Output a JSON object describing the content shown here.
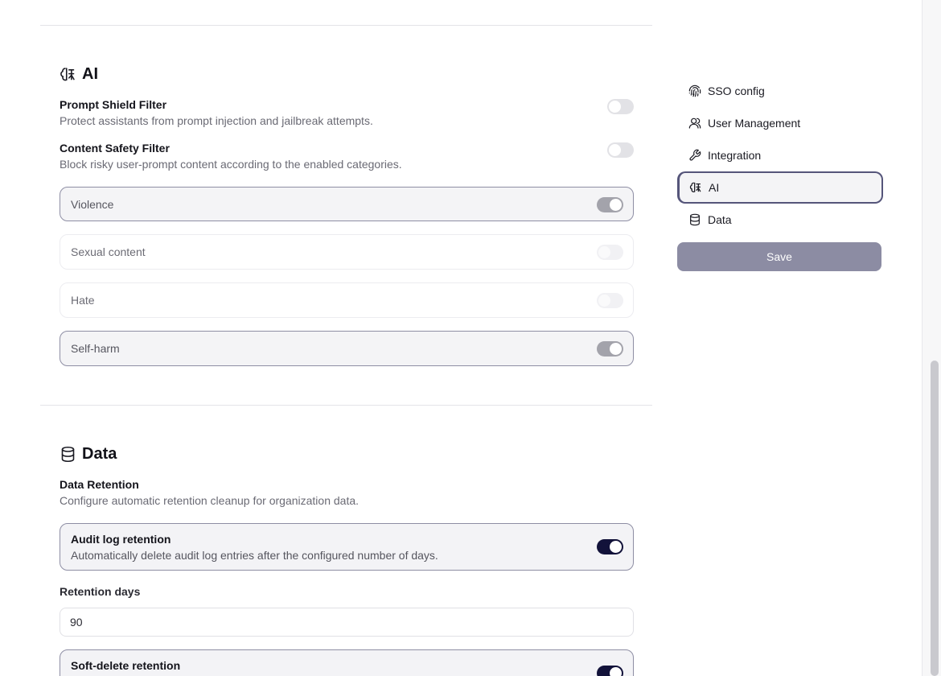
{
  "ai_section": {
    "title": "AI",
    "icon": "ai-brain-icon",
    "prompt_shield": {
      "title": "Prompt Shield Filter",
      "description": "Protect assistants from prompt injection and jailbreak attempts.",
      "enabled": false
    },
    "content_safety": {
      "title": "Content Safety Filter",
      "description": "Block risky user-prompt content according to the enabled categories.",
      "enabled": false
    },
    "categories": [
      {
        "label": "Violence",
        "enabled": true
      },
      {
        "label": "Sexual content",
        "enabled": false
      },
      {
        "label": "Hate",
        "enabled": false
      },
      {
        "label": "Self-harm",
        "enabled": true
      }
    ]
  },
  "data_section": {
    "title": "Data",
    "icon": "database-icon",
    "retention": {
      "title": "Data Retention",
      "description": "Configure automatic retention cleanup for organization data."
    },
    "audit_log": {
      "title": "Audit log retention",
      "description": "Automatically delete audit log entries after the configured number of days.",
      "enabled": true
    },
    "retention_days": {
      "label": "Retention days",
      "value": "90"
    },
    "soft_delete": {
      "title": "Soft-delete retention",
      "enabled": true
    }
  },
  "sidebar_nav": {
    "items": [
      {
        "label": "SSO config",
        "icon": "fingerprint-icon"
      },
      {
        "label": "User Management",
        "icon": "users-icon"
      },
      {
        "label": "Integration",
        "icon": "wrench-icon"
      },
      {
        "label": "AI",
        "icon": "ai-brain-icon",
        "active": true
      },
      {
        "label": "Data",
        "icon": "database-icon"
      }
    ],
    "save_label": "Save"
  },
  "colors": {
    "accent": "#12123a",
    "active_border": "#8e8ea4",
    "save_button": "#8c8ca3"
  }
}
